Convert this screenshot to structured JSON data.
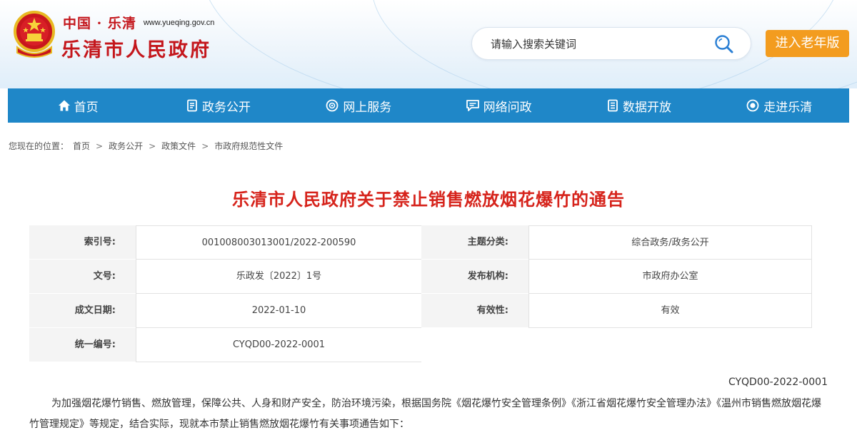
{
  "header": {
    "logo_cn": "中国 · 乐清",
    "logo_url": "www.yueqing.gov.cn",
    "logo_main": "乐清市人民政府",
    "search_placeholder": "请输入搜索关键词",
    "elder_button": "进入老年版",
    "accent_color": "#f39c1f",
    "brand_red": "#c4161c"
  },
  "nav": {
    "color": "#1f87c8",
    "items": [
      {
        "label": "首页",
        "icon": "home-icon"
      },
      {
        "label": "政务公开",
        "icon": "document-icon"
      },
      {
        "label": "网上服务",
        "icon": "service-icon"
      },
      {
        "label": "网络问政",
        "icon": "message-icon"
      },
      {
        "label": "数据开放",
        "icon": "data-icon"
      },
      {
        "label": "走进乐清",
        "icon": "eye-icon"
      }
    ]
  },
  "breadcrumb": {
    "prefix": "您现在的位置：",
    "items": [
      "首页",
      "政务公开",
      "政策文件",
      "市政府规范性文件"
    ],
    "separator": ">"
  },
  "article": {
    "title": "乐清市人民政府关于禁止销售燃放烟花爆竹的通告",
    "info": {
      "index_label": "索引号:",
      "index_value": "001008003013001/2022-200590",
      "category_label": "主题分类:",
      "category_value": "综合政务/政务公开",
      "docno_label": "文号:",
      "docno_value": "乐政发〔2022〕1号",
      "issuer_label": "发布机构:",
      "issuer_value": "市政府办公室",
      "date_label": "成文日期:",
      "date_value": "2022-01-10",
      "validity_label": "有效性:",
      "validity_value": "有效",
      "unified_label": "统一编号:",
      "unified_value": "CYQD00-2022-0001"
    },
    "doc_code": "CYQD00-2022-0001",
    "paragraph": "为加强烟花爆竹销售、燃放管理，保障公共、人身和财产安全，防治环境污染，根据国务院《烟花爆竹安全管理条例》《浙江省烟花爆竹安全管理办法》《温州市销售燃放烟花爆竹管理规定》等规定，结合实际，现就本市禁止销售燃放烟花爆竹有关事项通告如下："
  }
}
